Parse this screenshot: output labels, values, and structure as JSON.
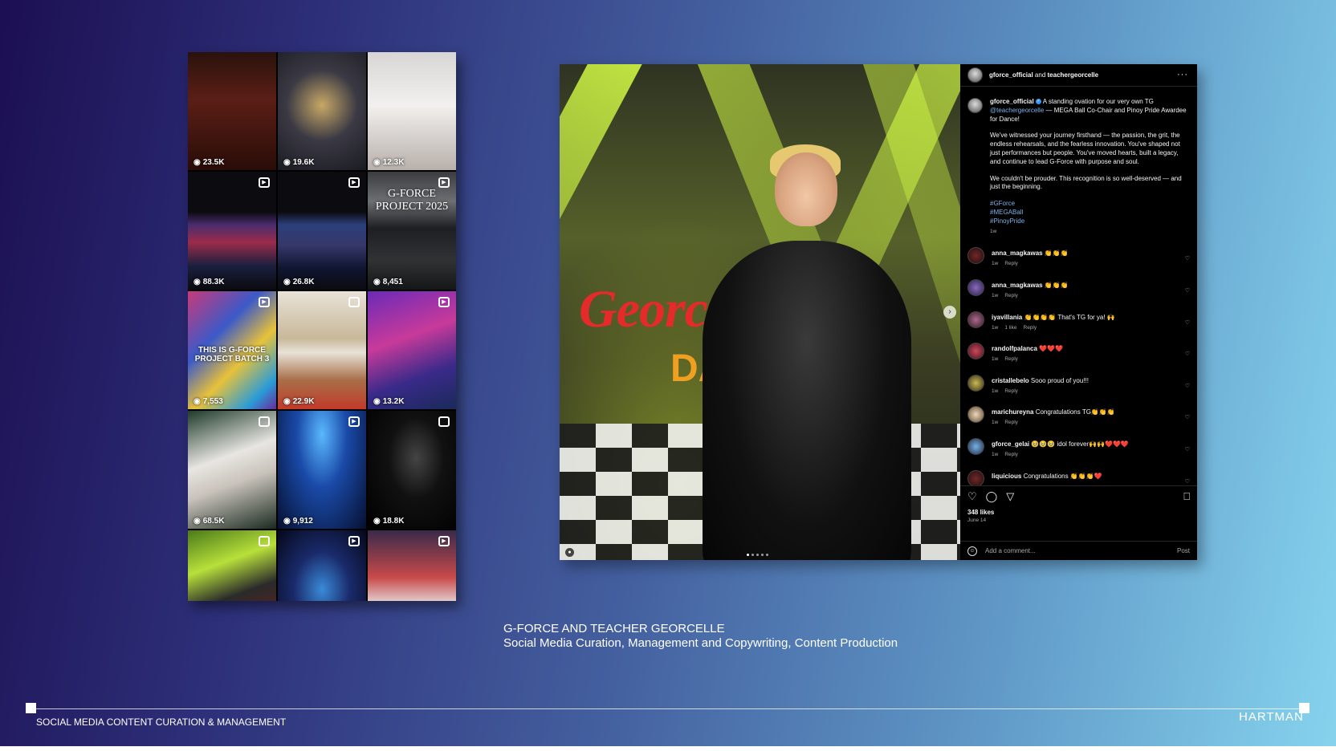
{
  "grid": {
    "tiles": [
      {
        "views": "23.5K",
        "badge": ""
      },
      {
        "views": "19.6K",
        "badge": ""
      },
      {
        "views": "12.3K",
        "badge": ""
      },
      {
        "views": "88.3K",
        "badge": "reel"
      },
      {
        "views": "26.8K",
        "badge": "reel"
      },
      {
        "views": "8,451",
        "badge": "reel",
        "overlay_title": "G-FORCE PROJECT 2025"
      },
      {
        "views": "7,553",
        "badge": "reel",
        "overlay_sub": "THIS IS G-FORCE PROJECT BATCH 3"
      },
      {
        "views": "22.9K",
        "badge": "carousel"
      },
      {
        "views": "13.2K",
        "badge": "reel"
      },
      {
        "views": "68.5K",
        "badge": "carousel"
      },
      {
        "views": "9,912",
        "badge": "reel"
      },
      {
        "views": "18.8K",
        "badge": "carousel"
      },
      {
        "views": "",
        "badge": "carousel"
      },
      {
        "views": "",
        "badge": "reel"
      },
      {
        "views": "",
        "badge": "reel"
      }
    ]
  },
  "post": {
    "photo": {
      "text_red": "Georce",
      "text_orange": "DA"
    },
    "header": {
      "user1": "gforce_official",
      "and": "and",
      "user2": "teachergeorcelle",
      "more": "···"
    },
    "caption": {
      "username": "gforce_official",
      "line1": "A standing ovation for our very own TG",
      "mention": "@teachergeorcelle",
      "line2": " — MEGA Ball Co-Chair and Pinoy Pride Awardee for Dance!",
      "para2": "We've witnessed your journey firsthand — the passion, the grit, the endless rehearsals, and the fearless innovation. You've shaped not just performances but people. You've moved hearts, built a legacy, and continue to lead G-Force with purpose and soul.",
      "para3": "We couldn't be prouder. This recognition is so well-deserved — and just the beginning.",
      "tag1": "#GForce",
      "tag2": "#MEGABall",
      "tag3": "#PinoyPride",
      "time": "1w"
    },
    "comments": [
      {
        "user": "anna_magkawas",
        "text": "👏👏👏",
        "time": "1w",
        "likes": "",
        "reply": "Reply"
      },
      {
        "user": "anna_magkawas",
        "text": "👏👏👏",
        "time": "1w",
        "likes": "",
        "reply": "Reply"
      },
      {
        "user": "iyavillania",
        "text": "👏👏👏👏 That's TG for ya! 🙌",
        "time": "1w",
        "likes": "1 like",
        "reply": "Reply"
      },
      {
        "user": "randolfpalanca",
        "text": "❤️❤️❤️",
        "time": "1w",
        "likes": "",
        "reply": "Reply"
      },
      {
        "user": "cristallebelo",
        "text": "Sooo proud of you!!!",
        "time": "1w",
        "likes": "",
        "reply": "Reply"
      },
      {
        "user": "marichureyna",
        "text": "Congratulations TG👏👏👏",
        "time": "1w",
        "likes": "",
        "reply": "Reply"
      },
      {
        "user": "gforce_gelai",
        "text": "🥹🥹🥹 idol forever🙌🙌❤️❤️❤️",
        "time": "1w",
        "likes": "",
        "reply": "Reply"
      },
      {
        "user": "liquicious",
        "text": "Congratulations 👏👏👏❤️",
        "time": "",
        "likes": "",
        "reply": ""
      }
    ],
    "likes": "348 likes",
    "date": "June 14",
    "add_comment_placeholder": "Add a comment...",
    "post_button": "Post"
  },
  "project": {
    "title": "G-FORCE AND TEACHER GEORCELLE",
    "subtitle": "Social Media Curation, Management and Copywriting, Content Production"
  },
  "footer": {
    "label": "SOCIAL MEDIA CONTENT CURATION & MANAGEMENT",
    "logo": "HARTMAN"
  }
}
